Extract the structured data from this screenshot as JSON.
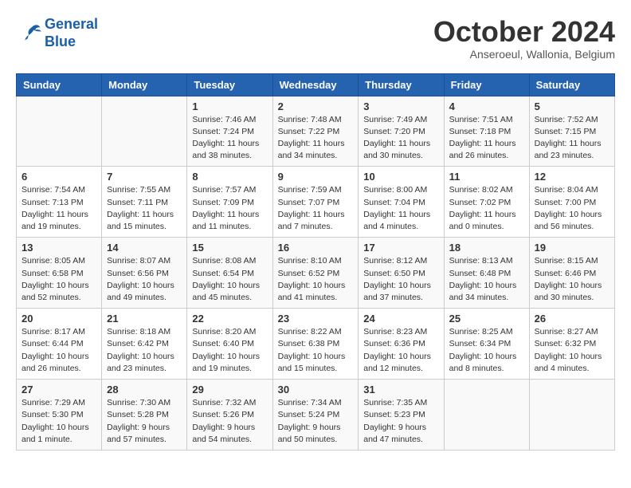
{
  "header": {
    "logo_line1": "General",
    "logo_line2": "Blue",
    "month": "October 2024",
    "location": "Anseroeul, Wallonia, Belgium"
  },
  "weekdays": [
    "Sunday",
    "Monday",
    "Tuesday",
    "Wednesday",
    "Thursday",
    "Friday",
    "Saturday"
  ],
  "weeks": [
    [
      {
        "day": "",
        "content": ""
      },
      {
        "day": "",
        "content": ""
      },
      {
        "day": "1",
        "content": "Sunrise: 7:46 AM\nSunset: 7:24 PM\nDaylight: 11 hours and 38 minutes."
      },
      {
        "day": "2",
        "content": "Sunrise: 7:48 AM\nSunset: 7:22 PM\nDaylight: 11 hours and 34 minutes."
      },
      {
        "day": "3",
        "content": "Sunrise: 7:49 AM\nSunset: 7:20 PM\nDaylight: 11 hours and 30 minutes."
      },
      {
        "day": "4",
        "content": "Sunrise: 7:51 AM\nSunset: 7:18 PM\nDaylight: 11 hours and 26 minutes."
      },
      {
        "day": "5",
        "content": "Sunrise: 7:52 AM\nSunset: 7:15 PM\nDaylight: 11 hours and 23 minutes."
      }
    ],
    [
      {
        "day": "6",
        "content": "Sunrise: 7:54 AM\nSunset: 7:13 PM\nDaylight: 11 hours and 19 minutes."
      },
      {
        "day": "7",
        "content": "Sunrise: 7:55 AM\nSunset: 7:11 PM\nDaylight: 11 hours and 15 minutes."
      },
      {
        "day": "8",
        "content": "Sunrise: 7:57 AM\nSunset: 7:09 PM\nDaylight: 11 hours and 11 minutes."
      },
      {
        "day": "9",
        "content": "Sunrise: 7:59 AM\nSunset: 7:07 PM\nDaylight: 11 hours and 7 minutes."
      },
      {
        "day": "10",
        "content": "Sunrise: 8:00 AM\nSunset: 7:04 PM\nDaylight: 11 hours and 4 minutes."
      },
      {
        "day": "11",
        "content": "Sunrise: 8:02 AM\nSunset: 7:02 PM\nDaylight: 11 hours and 0 minutes."
      },
      {
        "day": "12",
        "content": "Sunrise: 8:04 AM\nSunset: 7:00 PM\nDaylight: 10 hours and 56 minutes."
      }
    ],
    [
      {
        "day": "13",
        "content": "Sunrise: 8:05 AM\nSunset: 6:58 PM\nDaylight: 10 hours and 52 minutes."
      },
      {
        "day": "14",
        "content": "Sunrise: 8:07 AM\nSunset: 6:56 PM\nDaylight: 10 hours and 49 minutes."
      },
      {
        "day": "15",
        "content": "Sunrise: 8:08 AM\nSunset: 6:54 PM\nDaylight: 10 hours and 45 minutes."
      },
      {
        "day": "16",
        "content": "Sunrise: 8:10 AM\nSunset: 6:52 PM\nDaylight: 10 hours and 41 minutes."
      },
      {
        "day": "17",
        "content": "Sunrise: 8:12 AM\nSunset: 6:50 PM\nDaylight: 10 hours and 37 minutes."
      },
      {
        "day": "18",
        "content": "Sunrise: 8:13 AM\nSunset: 6:48 PM\nDaylight: 10 hours and 34 minutes."
      },
      {
        "day": "19",
        "content": "Sunrise: 8:15 AM\nSunset: 6:46 PM\nDaylight: 10 hours and 30 minutes."
      }
    ],
    [
      {
        "day": "20",
        "content": "Sunrise: 8:17 AM\nSunset: 6:44 PM\nDaylight: 10 hours and 26 minutes."
      },
      {
        "day": "21",
        "content": "Sunrise: 8:18 AM\nSunset: 6:42 PM\nDaylight: 10 hours and 23 minutes."
      },
      {
        "day": "22",
        "content": "Sunrise: 8:20 AM\nSunset: 6:40 PM\nDaylight: 10 hours and 19 minutes."
      },
      {
        "day": "23",
        "content": "Sunrise: 8:22 AM\nSunset: 6:38 PM\nDaylight: 10 hours and 15 minutes."
      },
      {
        "day": "24",
        "content": "Sunrise: 8:23 AM\nSunset: 6:36 PM\nDaylight: 10 hours and 12 minutes."
      },
      {
        "day": "25",
        "content": "Sunrise: 8:25 AM\nSunset: 6:34 PM\nDaylight: 10 hours and 8 minutes."
      },
      {
        "day": "26",
        "content": "Sunrise: 8:27 AM\nSunset: 6:32 PM\nDaylight: 10 hours and 4 minutes."
      }
    ],
    [
      {
        "day": "27",
        "content": "Sunrise: 7:29 AM\nSunset: 5:30 PM\nDaylight: 10 hours and 1 minute."
      },
      {
        "day": "28",
        "content": "Sunrise: 7:30 AM\nSunset: 5:28 PM\nDaylight: 9 hours and 57 minutes."
      },
      {
        "day": "29",
        "content": "Sunrise: 7:32 AM\nSunset: 5:26 PM\nDaylight: 9 hours and 54 minutes."
      },
      {
        "day": "30",
        "content": "Sunrise: 7:34 AM\nSunset: 5:24 PM\nDaylight: 9 hours and 50 minutes."
      },
      {
        "day": "31",
        "content": "Sunrise: 7:35 AM\nSunset: 5:23 PM\nDaylight: 9 hours and 47 minutes."
      },
      {
        "day": "",
        "content": ""
      },
      {
        "day": "",
        "content": ""
      }
    ]
  ]
}
